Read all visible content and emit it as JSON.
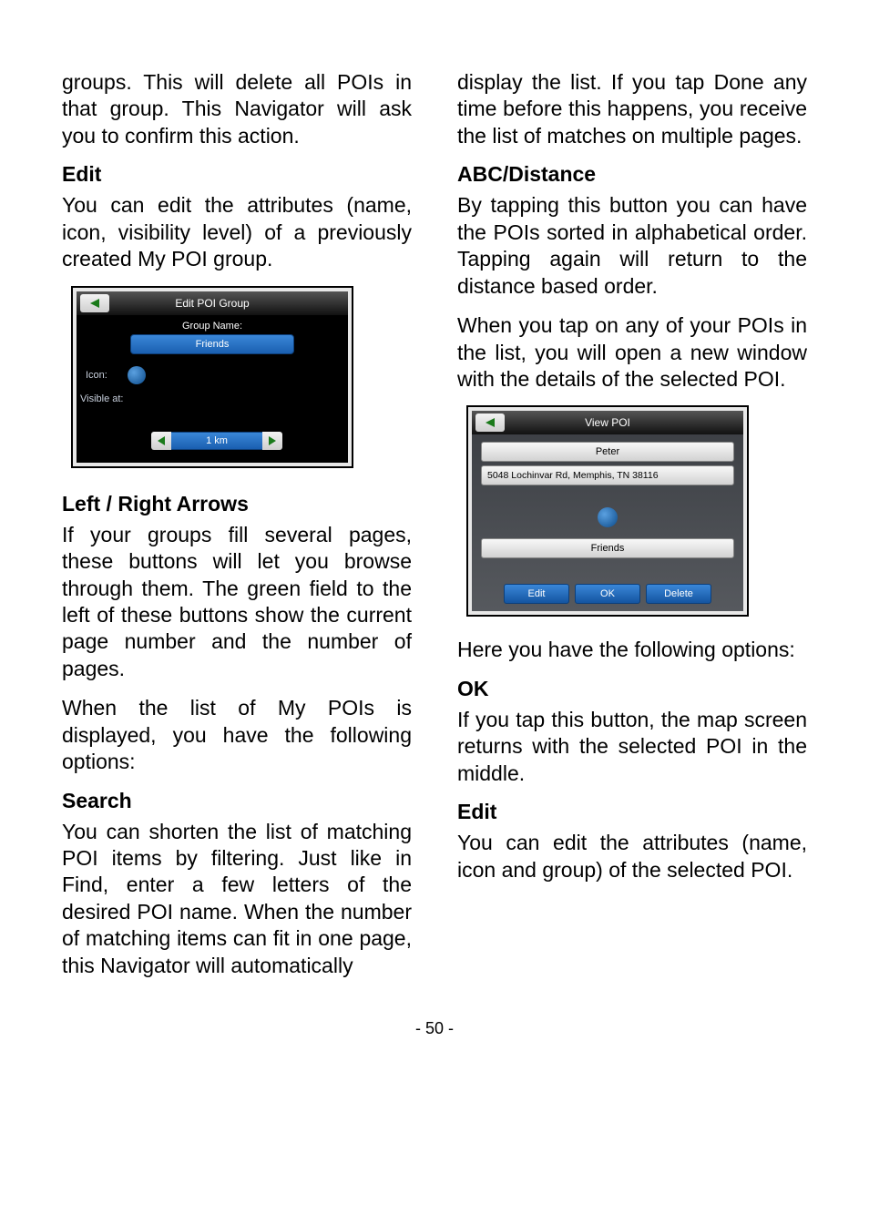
{
  "page_number": "- 50 -",
  "left": {
    "p1": "groups. This will delete all POIs in that group. This Navigator will ask you to confirm this action.",
    "h1": "Edit",
    "p2": "You can edit the attributes (name, icon, visibility level) of a previously created My POI group.",
    "h2": "Left / Right Arrows",
    "p3": "If your groups fill several pages, these buttons will let you browse through them. The green field to the left of these buttons show the current page number and the number of pages.",
    "p4": "When the list of My POIs is displayed, you have the following options:",
    "h3": "Search",
    "p5": "You can shorten the list of matching POI items by filtering. Just like in Find, enter a few letters of the desired POI name. When the number of matching items can fit in one page, this Navigator will automatically"
  },
  "right": {
    "p1": "display the list. If you tap Done any time before this happens, you receive the list of matches on multiple pages.",
    "h1": "ABC/Distance",
    "p2": "By tapping this button you can have the POIs sorted in alphabetical order. Tapping again will return to the distance based order.",
    "p3": "When you tap on any of your POIs in the list, you will open a new window with the details of the selected POI.",
    "p4": "Here you have the following options:",
    "h2": "OK",
    "p5": "If you tap this button, the map screen returns with the selected POI in the middle.",
    "h3": "Edit",
    "p6": "You can edit the attributes (name, icon and group) of the selected POI."
  },
  "poi_edit": {
    "title": "Edit POI Group",
    "group_name_label": "Group Name:",
    "group_name_value": "Friends",
    "icon_label": "Icon:",
    "visible_label": "Visible at:",
    "distance": "1 km"
  },
  "poi_view": {
    "title": "View POI",
    "name": "Peter",
    "address": "5048 Lochinvar Rd, Memphis, TN 38116",
    "group": "Friends",
    "btn_edit": "Edit",
    "btn_ok": "OK",
    "btn_delete": "Delete"
  }
}
